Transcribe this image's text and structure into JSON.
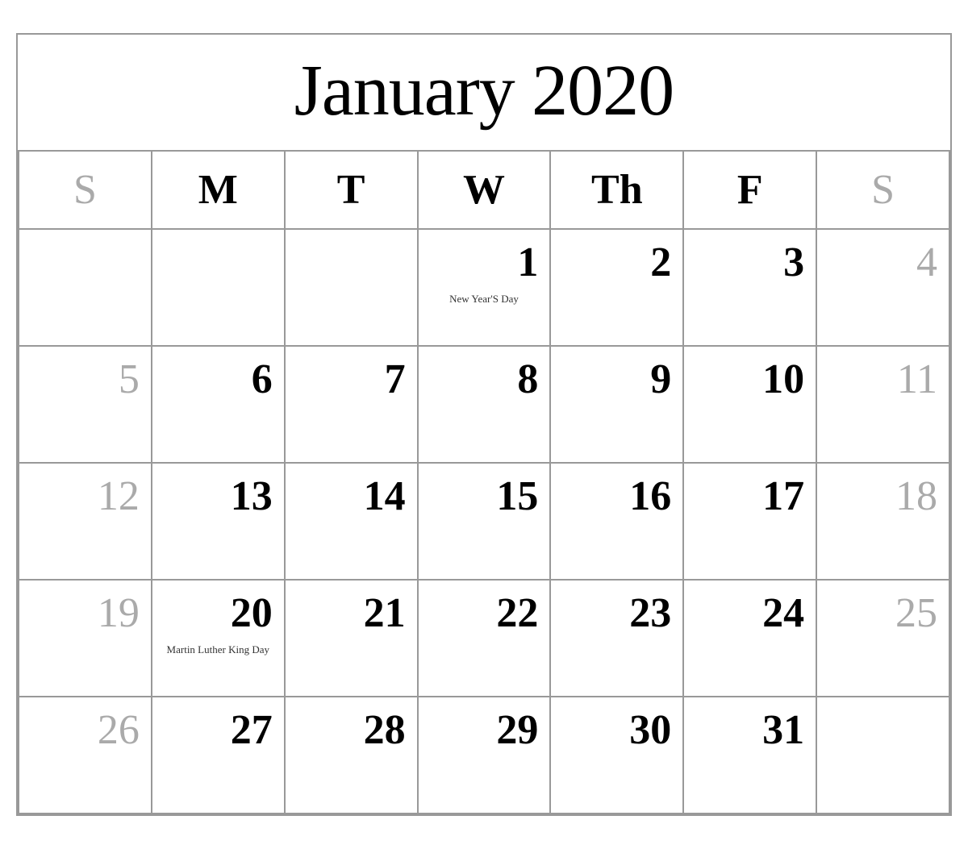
{
  "calendar": {
    "title": "January 2020",
    "headers": [
      {
        "label": "S",
        "type": "sunday"
      },
      {
        "label": "M",
        "type": "weekday"
      },
      {
        "label": "T",
        "type": "weekday"
      },
      {
        "label": "W",
        "type": "weekday"
      },
      {
        "label": "Th",
        "type": "weekday"
      },
      {
        "label": "F",
        "type": "weekday"
      },
      {
        "label": "S",
        "type": "saturday"
      }
    ],
    "weeks": [
      [
        {
          "day": "",
          "weekend": true
        },
        {
          "day": "",
          "weekend": false
        },
        {
          "day": "",
          "weekend": false
        },
        {
          "day": "1",
          "weekend": false,
          "holiday": "New Year'S Day"
        },
        {
          "day": "2",
          "weekend": false
        },
        {
          "day": "3",
          "weekend": false
        },
        {
          "day": "4",
          "weekend": true
        }
      ],
      [
        {
          "day": "5",
          "weekend": true
        },
        {
          "day": "6",
          "weekend": false
        },
        {
          "day": "7",
          "weekend": false
        },
        {
          "day": "8",
          "weekend": false
        },
        {
          "day": "9",
          "weekend": false
        },
        {
          "day": "10",
          "weekend": false
        },
        {
          "day": "11",
          "weekend": true
        }
      ],
      [
        {
          "day": "12",
          "weekend": true
        },
        {
          "day": "13",
          "weekend": false
        },
        {
          "day": "14",
          "weekend": false
        },
        {
          "day": "15",
          "weekend": false
        },
        {
          "day": "16",
          "weekend": false
        },
        {
          "day": "17",
          "weekend": false
        },
        {
          "day": "18",
          "weekend": true
        }
      ],
      [
        {
          "day": "19",
          "weekend": true
        },
        {
          "day": "20",
          "weekend": false,
          "holiday": "Martin Luther King Day"
        },
        {
          "day": "21",
          "weekend": false
        },
        {
          "day": "22",
          "weekend": false
        },
        {
          "day": "23",
          "weekend": false
        },
        {
          "day": "24",
          "weekend": false
        },
        {
          "day": "25",
          "weekend": true
        }
      ],
      [
        {
          "day": "26",
          "weekend": true
        },
        {
          "day": "27",
          "weekend": false
        },
        {
          "day": "28",
          "weekend": false
        },
        {
          "day": "29",
          "weekend": false
        },
        {
          "day": "30",
          "weekend": false
        },
        {
          "day": "31",
          "weekend": false
        },
        {
          "day": "",
          "weekend": true
        }
      ]
    ]
  }
}
